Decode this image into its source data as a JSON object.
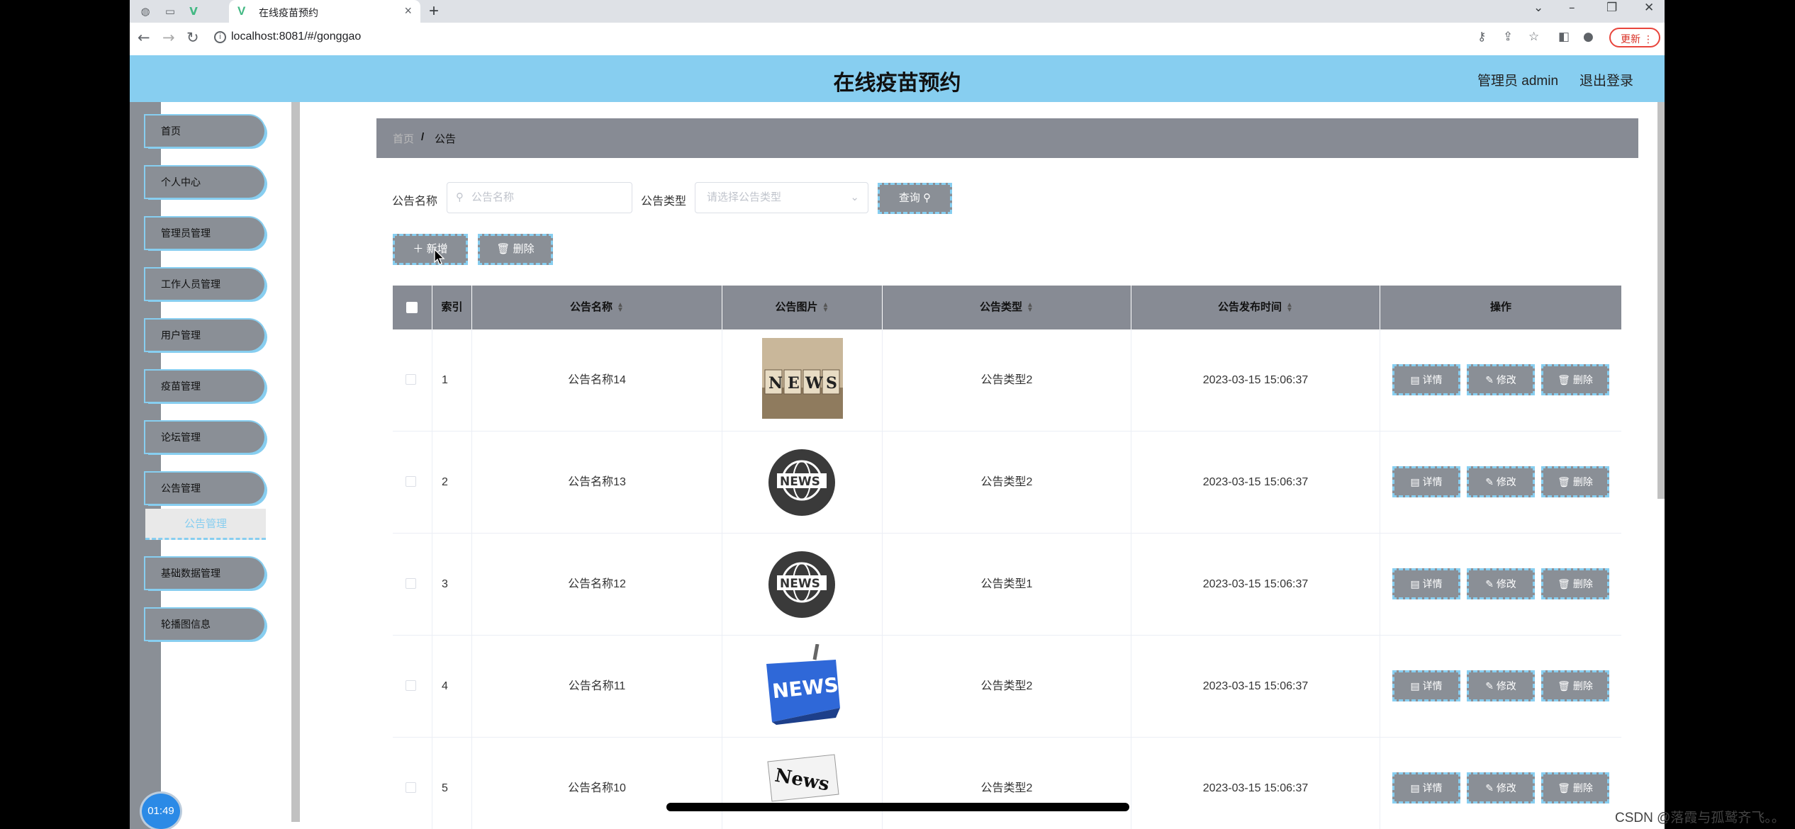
{
  "browser": {
    "tab_title": "在线疫苗预约",
    "url": "localhost:8081/#/gonggao",
    "update_label": "更新"
  },
  "header": {
    "title": "在线疫苗预约",
    "user": "管理员 admin",
    "logout": "退出登录"
  },
  "sidebar": {
    "items": [
      "首页",
      "个人中心",
      "管理员管理",
      "工作人员管理",
      "用户管理",
      "疫苗管理",
      "论坛管理",
      "公告管理"
    ],
    "active_sub": "公告管理",
    "items_after": [
      "基础数据管理",
      "轮播图信息"
    ]
  },
  "breadcrumb": {
    "home": "首页",
    "sep": "/",
    "current": "公告"
  },
  "search": {
    "name_label": "公告名称",
    "name_placeholder": "公告名称",
    "type_label": "公告类型",
    "type_placeholder": "请选择公告类型",
    "query_button": "查询"
  },
  "actions": {
    "add": "新增",
    "delete": "删除"
  },
  "table": {
    "columns": [
      "索引",
      "公告名称",
      "公告图片",
      "公告类型",
      "公告发布时间",
      "操作"
    ],
    "rows": [
      {
        "index": "1",
        "name": "公告名称14",
        "type": "公告类型2",
        "time": "2023-03-15 15:06:37",
        "image": "news-blocks"
      },
      {
        "index": "2",
        "name": "公告名称13",
        "type": "公告类型2",
        "time": "2023-03-15 15:06:37",
        "image": "news-globe"
      },
      {
        "index": "3",
        "name": "公告名称12",
        "type": "公告类型1",
        "time": "2023-03-15 15:06:37",
        "image": "news-globe"
      },
      {
        "index": "4",
        "name": "公告名称11",
        "type": "公告类型2",
        "time": "2023-03-15 15:06:37",
        "image": "news-key"
      },
      {
        "index": "5",
        "name": "公告名称10",
        "type": "公告类型2",
        "time": "2023-03-15 15:06:37",
        "image": "news-paper"
      }
    ],
    "row_buttons": {
      "detail": "详情",
      "edit": "修改",
      "delete": "删除"
    }
  },
  "overlay": {
    "timer": "01:49",
    "watermark": "CSDN @落霞与孤鹫齐飞。。"
  },
  "colors": {
    "accent": "#87cef0",
    "button_gray": "#8a8f96"
  }
}
